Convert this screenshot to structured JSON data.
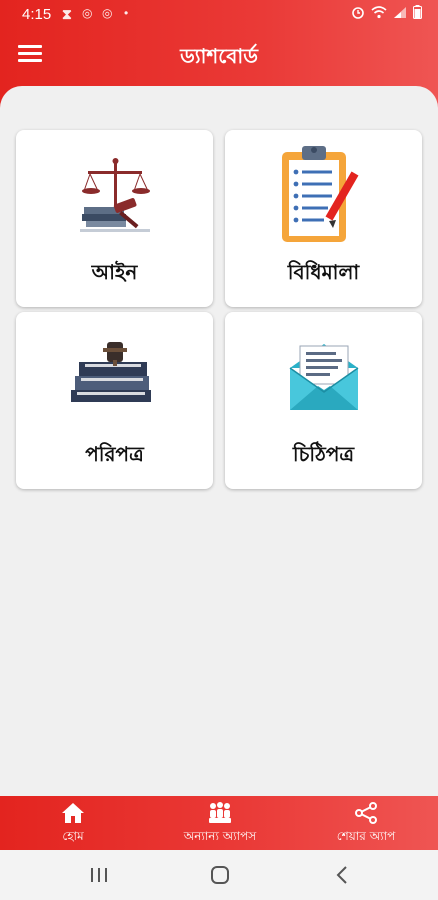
{
  "status_bar": {
    "time": "4:15"
  },
  "header": {
    "title": "ড্যাশবোর্ড"
  },
  "cards": [
    {
      "label": "আইন",
      "icon": "law-scale-gavel-icon"
    },
    {
      "label": "বিধিমালা",
      "icon": "clipboard-checklist-icon"
    },
    {
      "label": "পরিপত্র",
      "icon": "books-gavel-icon"
    },
    {
      "label": "চিঠিপত্র",
      "icon": "envelope-letter-icon"
    }
  ],
  "bottom_nav": [
    {
      "label": "হোম",
      "icon": "home-icon"
    },
    {
      "label": "অন্যান্য অ্যাপস",
      "icon": "people-icon"
    },
    {
      "label": "শেয়ার অ্যাপ",
      "icon": "share-icon"
    }
  ],
  "colors": {
    "primary_red": "#e3241f",
    "background": "#f0f0f0",
    "card": "#ffffff"
  }
}
